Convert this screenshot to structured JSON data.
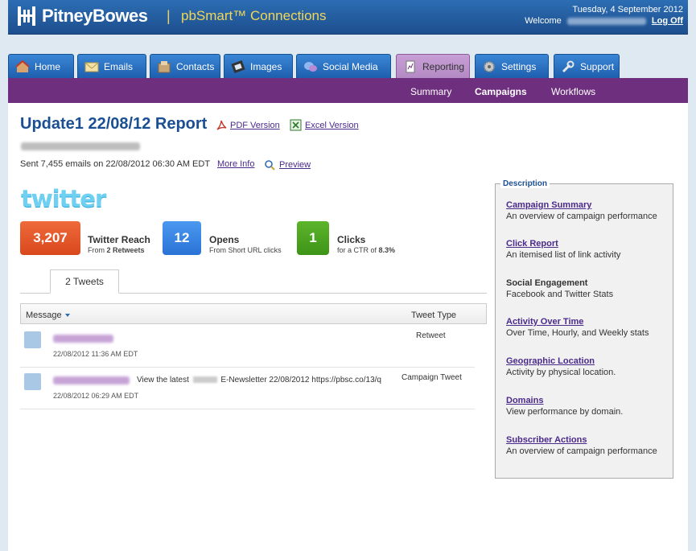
{
  "header": {
    "brand": "PitneyBowes",
    "separator": "|",
    "product": "pbSmart™ Connections",
    "date": "Tuesday, 4 September 2012",
    "welcome": "Welcome",
    "logout": "Log Off"
  },
  "tabs": [
    {
      "label": "Home"
    },
    {
      "label": "Emails"
    },
    {
      "label": "Contacts"
    },
    {
      "label": "Images"
    },
    {
      "label": "Social Media"
    },
    {
      "label": "Reporting"
    },
    {
      "label": "Settings"
    },
    {
      "label": "Support"
    }
  ],
  "subnav": {
    "summary": "Summary",
    "campaigns": "Campaigns",
    "workflows": "Workflows"
  },
  "report": {
    "title": "Update1 22/08/12 Report",
    "pdf_label": "PDF Version",
    "excel_label": "Excel Version",
    "sent_text": "Sent 7,455 emails on 22/08/2012 06:30 AM EDT",
    "more_info": "More Info",
    "preview": "Preview"
  },
  "twitter": {
    "logo": "twitter",
    "reach": {
      "value": "3,207",
      "label": "Twitter Reach",
      "sub_prefix": "From ",
      "sub_bold": "2 Retweets"
    },
    "opens": {
      "value": "12",
      "label": "Opens",
      "sub": "From Short URL clicks"
    },
    "clicks": {
      "value": "1",
      "label": "Clicks",
      "sub_prefix": "for a CTR of ",
      "sub_bold": "8.3%"
    },
    "tab_label": "2 Tweets",
    "col_message": "Message",
    "col_type": "Tweet Type",
    "rows": [
      {
        "message": "",
        "timestamp": "22/08/2012 11:36 AM EDT",
        "type": "Retweet"
      },
      {
        "message_prefix": "View the latest",
        "message_suffix": "E-Newsletter 22/08/2012 https://pbsc.co/13/q",
        "timestamp": "22/08/2012 06:29 AM EDT",
        "type": "Campaign Tweet"
      }
    ]
  },
  "description": {
    "legend": "Description",
    "items": [
      {
        "heading": "Campaign Summary",
        "text": "An overview of campaign performance"
      },
      {
        "heading": "Click Report",
        "text": "An itemised list of link activity"
      },
      {
        "heading": "Social Engagement",
        "text": "Facebook and Twitter Stats"
      },
      {
        "heading": "Activity Over Time",
        "text": "Over Time, Hourly, and Weekly stats"
      },
      {
        "heading": "Geographic Location",
        "text": "Activity by physical location."
      },
      {
        "heading": "Domains",
        "text": "View performance by domain."
      },
      {
        "heading": "Subscriber Actions",
        "text": "An overview of campaign performance"
      }
    ]
  },
  "colors": {
    "header_blue": "#1d4f8e",
    "tab_blue": "#2d74c4",
    "subnav_purple": "#6e2f7e",
    "reach_orange": "#e2562a",
    "opens_blue": "#2f7fe0",
    "clicks_green": "#4aa31f"
  }
}
